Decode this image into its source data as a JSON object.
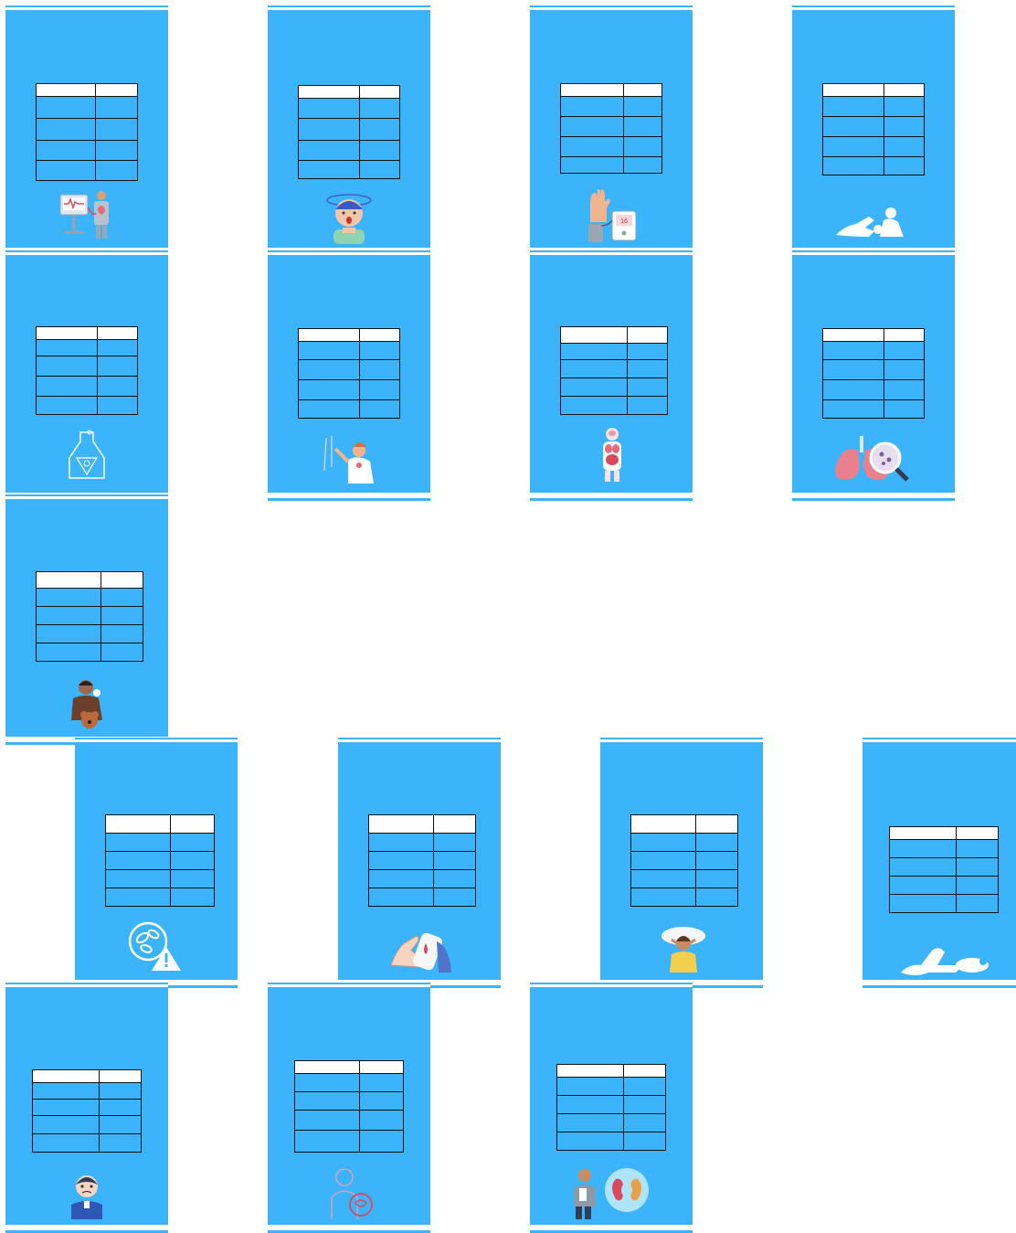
{
  "colors": {
    "card_background": "#3bb4fc",
    "table_header": "#ffffff",
    "table_line": "#111111"
  },
  "cards": [
    {
      "icon": "patient-monitor-icon",
      "rows": 5
    },
    {
      "icon": "dizzy-person-icon",
      "rows": 5
    },
    {
      "icon": "blood-pressure-monitor-icon",
      "rows": 5
    },
    {
      "icon": "cpr-first-aid-icon",
      "rows": 5
    },
    {
      "icon": "poison-bottle-icon",
      "rows": 5
    },
    {
      "icon": "person-shock-icon",
      "rows": 5
    },
    {
      "icon": "human-organs-icon",
      "rows": 5
    },
    {
      "icon": "lungs-magnifier-icon",
      "rows": 5
    },
    {
      "icon": "allergy-person-pet-icon",
      "rows": 5
    },
    {
      "icon": "pills-warning-icon",
      "rows": 5
    },
    {
      "icon": "glucose-meter-icon",
      "rows": 5
    },
    {
      "icon": "headache-woman-icon",
      "rows": 5
    },
    {
      "icon": "collapsed-person-icon",
      "rows": 5
    },
    {
      "icon": "stressed-man-icon",
      "rows": 5
    },
    {
      "icon": "stomach-person-icon",
      "rows": 5
    },
    {
      "icon": "kidney-doctor-icon",
      "rows": 5
    }
  ]
}
